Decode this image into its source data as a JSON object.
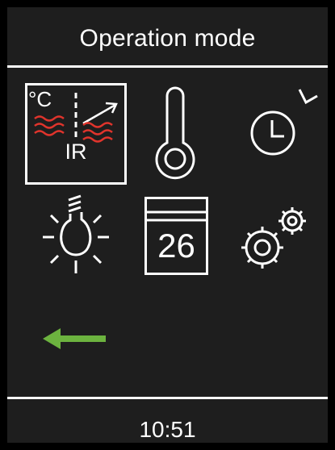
{
  "header": {
    "title": "Operation mode"
  },
  "tiles": [
    {
      "name": "IR heating mode",
      "icon": "ir-heating-icon",
      "selected": true,
      "unit_label": "°C",
      "label": "IR"
    },
    {
      "name": "Temperature",
      "icon": "thermometer-icon",
      "selected": false
    },
    {
      "name": "Timer",
      "icon": "clock-icon",
      "selected": false
    },
    {
      "name": "Lighting",
      "icon": "light-bulb-icon",
      "selected": false
    },
    {
      "name": "Calendar",
      "icon": "calendar-icon",
      "selected": false,
      "day": "26"
    },
    {
      "name": "Settings",
      "icon": "gears-icon",
      "selected": false
    }
  ],
  "back": {
    "icon": "back-arrow-icon"
  },
  "footer": {
    "time": "10:51"
  },
  "colors": {
    "background": "#1e1e1e",
    "bezel": "#000000",
    "foreground": "#ffffff",
    "accent_heat": "#e0342c",
    "accent_back": "#6cb33f"
  }
}
